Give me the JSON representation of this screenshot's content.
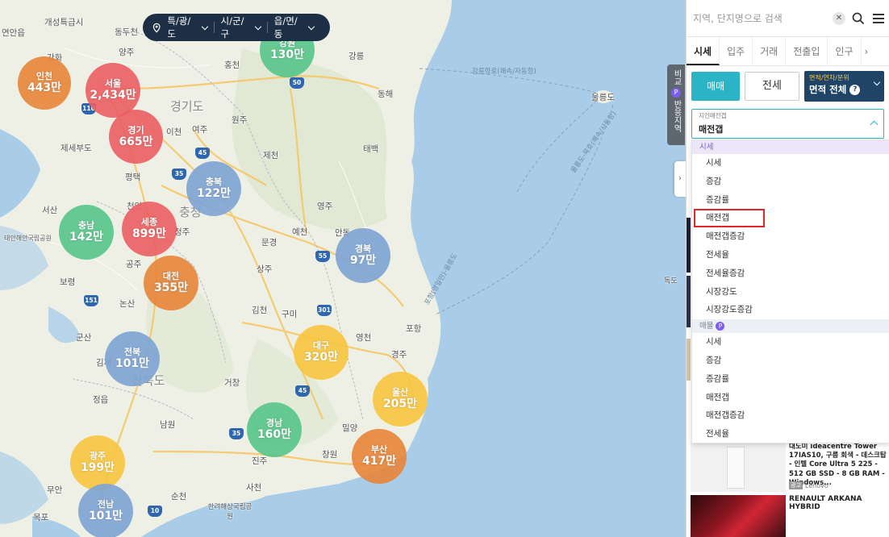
{
  "map": {
    "region_selector": {
      "level1": "특/광/도",
      "level2": "시/군/구",
      "level3": "읍/면/동"
    },
    "compare_tab": {
      "label_top": "비교",
      "badge": "P",
      "label_bottom": "반응지역"
    },
    "clusters": [
      {
        "name": "인천",
        "value": "443만",
        "color": "#e8853a"
      },
      {
        "name": "서울",
        "value": "2,434만",
        "color": "#ec5f63"
      },
      {
        "name": "경기",
        "value": "665만",
        "color": "#ec5f63"
      },
      {
        "name": "강원",
        "value": "130만",
        "color": "#57c58a"
      },
      {
        "name": "충북",
        "value": "122만",
        "color": "#7ea4d4"
      },
      {
        "name": "충남",
        "value": "142만",
        "color": "#57c58a"
      },
      {
        "name": "세종",
        "value": "899만",
        "color": "#ec5f63"
      },
      {
        "name": "대전",
        "value": "355만",
        "color": "#e8853a"
      },
      {
        "name": "경북",
        "value": "97만",
        "color": "#7ea4d4"
      },
      {
        "name": "전북",
        "value": "101만",
        "color": "#7ea4d4"
      },
      {
        "name": "대구",
        "value": "320만",
        "color": "#f8c63f"
      },
      {
        "name": "울산",
        "value": "205만",
        "color": "#f8c63f"
      },
      {
        "name": "경남",
        "value": "160만",
        "color": "#57c58a"
      },
      {
        "name": "부산",
        "value": "417만",
        "color": "#e8853a"
      },
      {
        "name": "광주",
        "value": "199만",
        "color": "#f8c63f"
      },
      {
        "name": "전남",
        "value": "101만",
        "color": "#7ea4d4"
      }
    ],
    "places": [
      "연안읍",
      "개성특급시",
      "동두천",
      "양주",
      "홍천",
      "강릉",
      "강화",
      "동해",
      "경기도",
      "원주",
      "이천",
      "여주",
      "제세부도",
      "제천",
      "태백",
      "평택",
      "천안",
      "영주",
      "서산",
      "충청",
      "예천",
      "태안해안국립공원",
      "청주",
      "문경",
      "안동",
      "상주",
      "보령",
      "공주",
      "논산",
      "김천",
      "구미",
      "포항",
      "군산",
      "영천",
      "김제",
      "경주",
      "전북도",
      "거창",
      "정읍",
      "남원",
      "밀양",
      "진주",
      "창원",
      "무안",
      "순천",
      "사천",
      "목포",
      "한려해상국립공원",
      "울릉도",
      "독도"
    ],
    "roads": [
      "50",
      "110",
      "45",
      "35",
      "55",
      "151",
      "301",
      "45",
      "35",
      "10"
    ],
    "sea_labels": [
      "강릉항로(쾌속/자동항)",
      "울릉도-묵호(쾌속/사동항)",
      "포항(영일만)-울릉도"
    ]
  },
  "panel": {
    "search": {
      "placeholder": "지역, 단지명으로 검색"
    },
    "tabs": [
      "시세",
      "입주",
      "거래",
      "전출입",
      "인구"
    ],
    "trade": {
      "sale": "매매",
      "jeonse": "전세"
    },
    "area": {
      "small": "면적/연차/분위",
      "main": "면적 전체"
    },
    "metric": {
      "label": "지인매전갭",
      "value": "매전갭"
    },
    "dropdown": {
      "group1": "시세",
      "group1_items": [
        "시세",
        "증감",
        "증감률",
        "매전갭",
        "매전갭증감",
        "전세율",
        "전세율증감",
        "시장강도",
        "시장강도증감"
      ],
      "group2": "매물",
      "group2_items": [
        "시세",
        "증감",
        "증감률",
        "매전갭",
        "매전갭증감",
        "전세율"
      ]
    },
    "ad1": {
      "title": "대도미 ideacentre Tower 17IAS10, 구름 회색 - 데스크탑 - 인텔 Core Ultra 5 225 - 512 GB SSD - 8 GB RAM - Windows...",
      "badge": "광고",
      "brand": "Lenovo"
    },
    "ad2": {
      "title": "RENAULT ARKANA HYBRID"
    }
  }
}
